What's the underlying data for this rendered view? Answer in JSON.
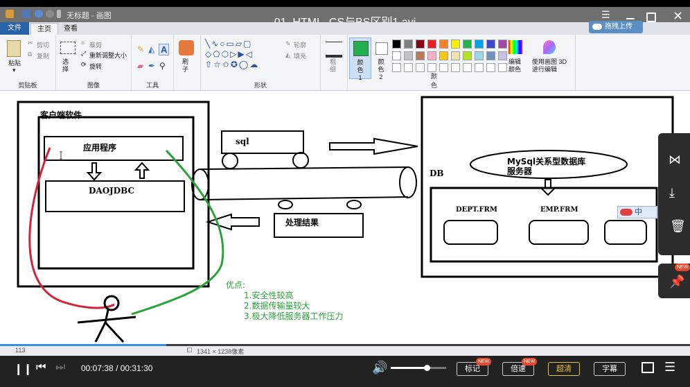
{
  "player": {
    "video_title": "01_HTML_CS与BS区别1.avi",
    "upload_label": "拖拽上传",
    "current_time": "00:07:38",
    "separator": "/",
    "total_time": "00:31:30",
    "progress": 0.24,
    "volume": 0.65,
    "mark_label": "标记",
    "speed_label": "倍速",
    "quality_label": "超清",
    "subtitle_label": "字幕",
    "new_badge": "NEW",
    "side_new_badge": "NEW"
  },
  "paint": {
    "window_title": "无标题 - 画图",
    "tabs": [
      "文件",
      "主页",
      "查看"
    ],
    "clipboard": {
      "paste": "粘贴",
      "cut": "剪切",
      "copy": "复制",
      "group": "剪贴板"
    },
    "image": {
      "crop": "裁剪",
      "select": "选择",
      "resize": "重新调整大小",
      "rotate": "旋转",
      "group": "图像"
    },
    "tools": {
      "group": "工具"
    },
    "brush": {
      "label": "刷子"
    },
    "shapes": {
      "outline": "轮廓",
      "fill": "填充",
      "group": "形状"
    },
    "size": {
      "label": "粗细"
    },
    "color1": "颜色 1",
    "color2": "颜色 2",
    "colors_group": "颜色",
    "edit_colors": "编辑颜色",
    "paint3d": "使用画图 3D 进行编辑",
    "status_size": "1341 × 1238像素",
    "status_pos": "113"
  },
  "palette": [
    "#000000",
    "#7f7f7f",
    "#880015",
    "#ed1c24",
    "#ff7f27",
    "#fff200",
    "#22b14c",
    "#00a2e8",
    "#3f48cc",
    "#a349a4",
    "#ffffff",
    "#c3c3c3",
    "#b97a57",
    "#ffaec9",
    "#ffc90e",
    "#efe4b0",
    "#b5e61d",
    "#99d9ea",
    "#7092be",
    "#c8bfe7"
  ],
  "diagram": {
    "client_title": "客户端软件",
    "app": "应用程序",
    "dao": "DAO",
    "jdbc": "JDBC",
    "sql": "sql",
    "result": "处理结果",
    "db": "DB",
    "mysql": "MySql关系型数据库",
    "server": "服务器",
    "dept": "DEPT.FRM",
    "emp": "EMP.FRM",
    "ime": "中",
    "adv_title": "优点:",
    "adv": [
      "1.安全性较高",
      "2.数据传输量较大",
      "3.极大降低服务器工作压力"
    ]
  }
}
